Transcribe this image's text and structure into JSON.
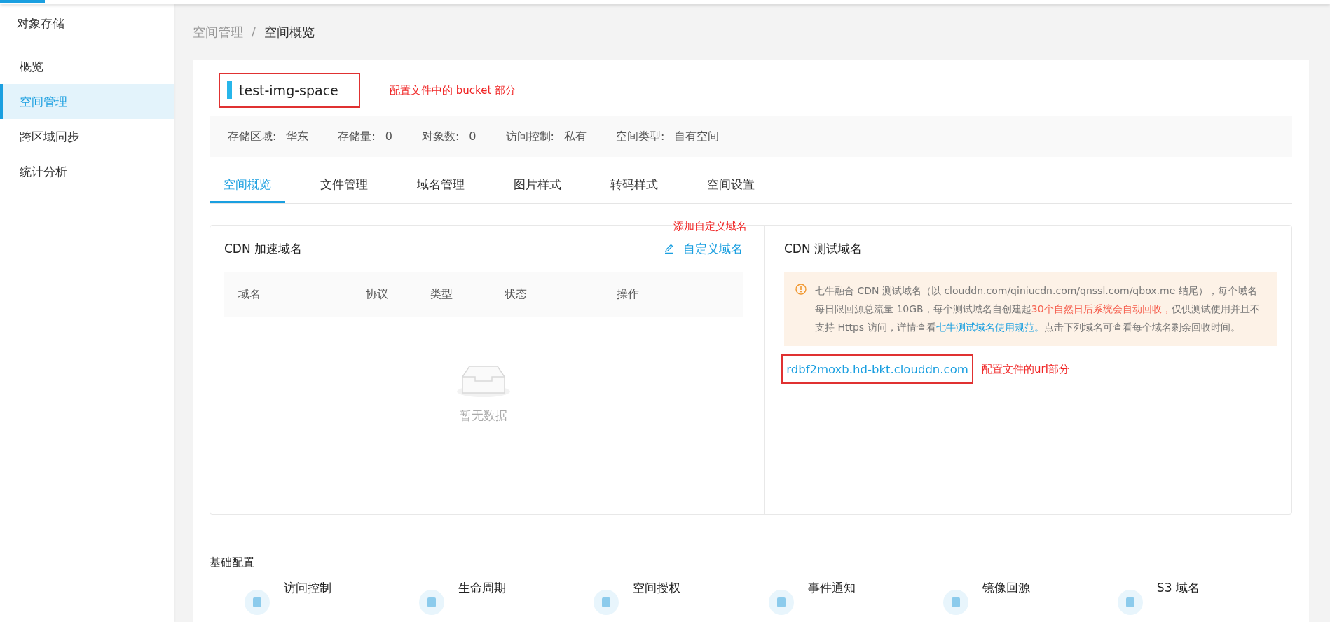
{
  "sidebar": {
    "title": "对象存储",
    "items": [
      {
        "label": "概览",
        "selected": false
      },
      {
        "label": "空间管理",
        "selected": true
      },
      {
        "label": "跨区域同步",
        "selected": false
      },
      {
        "label": "统计分析",
        "selected": false
      }
    ]
  },
  "breadcrumb": [
    "空间管理",
    "空间概览"
  ],
  "breadcrumb_separator": "/",
  "bucket": {
    "name": "test-img-space",
    "annotation": "配置文件中的 bucket 部分"
  },
  "info": [
    {
      "label": "存储区域:",
      "value": "华东"
    },
    {
      "label": "存储量:",
      "value": "0"
    },
    {
      "label": "对象数:",
      "value": "0"
    },
    {
      "label": "访问控制:",
      "value": "私有"
    },
    {
      "label": "空间类型:",
      "value": "自有空间"
    }
  ],
  "tabs": [
    {
      "label": "空间概览",
      "selected": true
    },
    {
      "label": "文件管理",
      "selected": false
    },
    {
      "label": "域名管理",
      "selected": false
    },
    {
      "label": "图片样式",
      "selected": false
    },
    {
      "label": "转码样式",
      "selected": false
    },
    {
      "label": "空间设置",
      "selected": false
    }
  ],
  "cdn": {
    "title": "CDN 加速域名",
    "annotation": "添加自定义域名",
    "custom_link": "自定义域名",
    "columns": [
      "域名",
      "协议",
      "类型",
      "状态",
      "操作"
    ],
    "empty_text": "暂无数据"
  },
  "test_domain": {
    "title": "CDN 测试域名",
    "notice": "七牛融合 CDN 测试域名（以 clouddn.com/qiniucdn.com/qnssl.com/qbox.me 结尾），每个域名每日限回源总流量 10GB，每个测试域名自创建起",
    "notice_warning": "30个自然日后系统会自动回收，",
    "notice_mid": "仅供测试使用并且不支持 Https 访问，详情查看",
    "notice_link": "七牛测试域名使用规范。",
    "notice_end": "点击下列域名可查看每个域名剩余回收时间。",
    "domain": "rdbf2moxb.hd-bkt.clouddn.com",
    "annotation": "配置文件的url部分"
  },
  "basic_config": {
    "title": "基础配置",
    "items": [
      {
        "label": "访问控制"
      },
      {
        "label": "生命周期"
      },
      {
        "label": "空间授权"
      },
      {
        "label": "事件通知"
      },
      {
        "label": "镜像回源"
      },
      {
        "label": "S3 域名"
      }
    ]
  }
}
